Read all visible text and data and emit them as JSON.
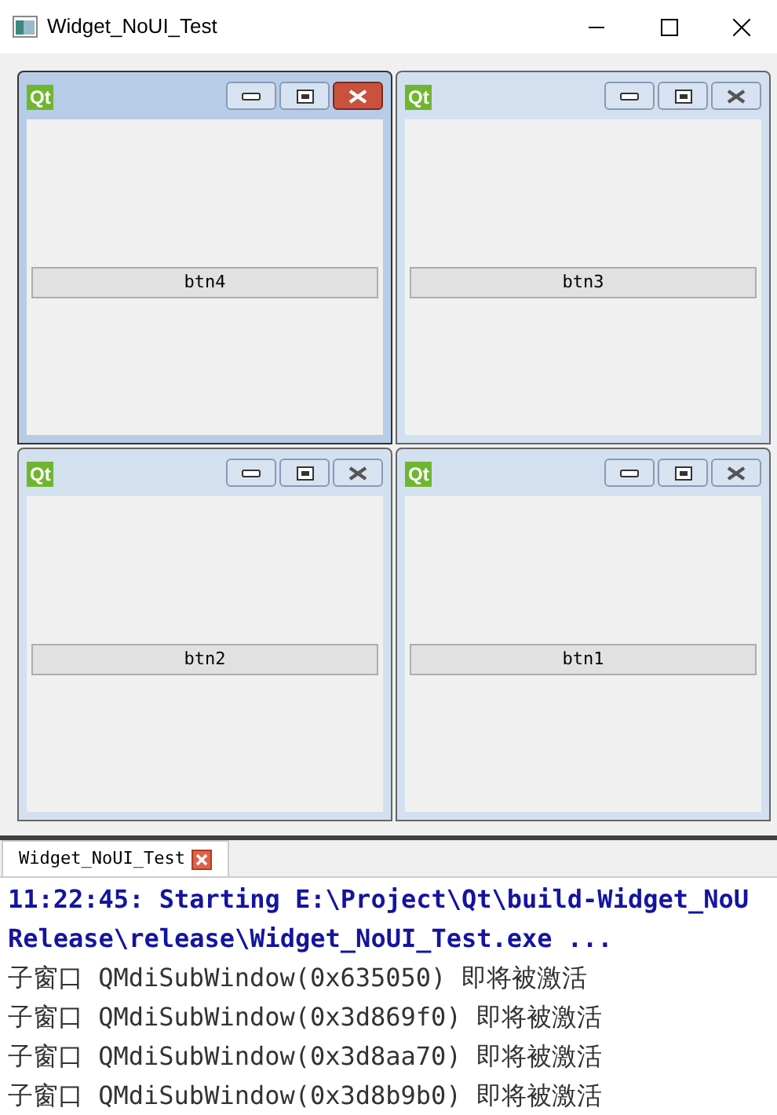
{
  "window": {
    "title": "Widget_NoUI_Test"
  },
  "subwindows": [
    {
      "logo": "Qt",
      "button": "btn4",
      "active": true
    },
    {
      "logo": "Qt",
      "button": "btn3",
      "active": false
    },
    {
      "logo": "Qt",
      "button": "btn2",
      "active": false
    },
    {
      "logo": "Qt",
      "button": "btn1",
      "active": false
    }
  ],
  "output": {
    "tab": {
      "label": "Widget_NoUI_Test",
      "selected": true
    },
    "lines": [
      {
        "kind": "status",
        "text": "11:22:45: Starting E:\\Project\\Qt\\build-Widget_NoU"
      },
      {
        "kind": "status",
        "text": "Release\\release\\Widget_NoUI_Test.exe ..."
      },
      {
        "kind": "log",
        "text": "子窗口 QMdiSubWindow(0x635050) 即将被激活"
      },
      {
        "kind": "log",
        "text": "子窗口 QMdiSubWindow(0x3d869f0) 即将被激活"
      },
      {
        "kind": "log",
        "text": "子窗口 QMdiSubWindow(0x3d8aa70) 即将被激活"
      },
      {
        "kind": "log",
        "text": "子窗口 QMdiSubWindow(0x3d8b9b0) 即将被激活"
      }
    ]
  }
}
